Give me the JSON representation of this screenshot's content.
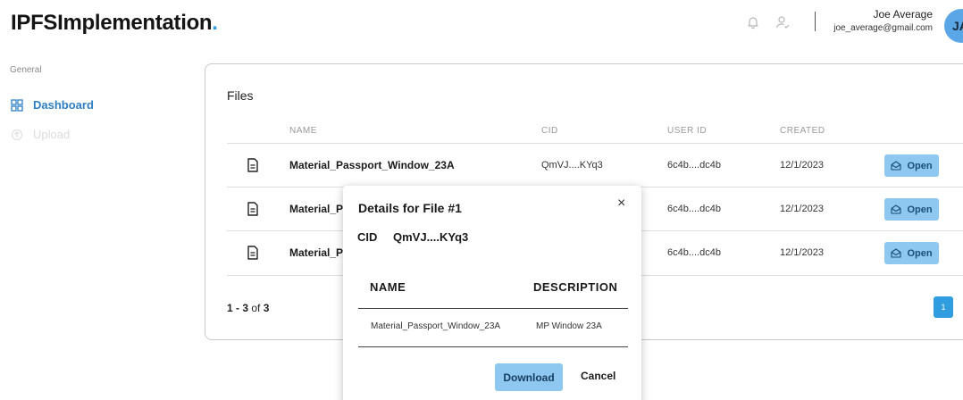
{
  "brand": {
    "name": "IPFSImplementation",
    "dot": "."
  },
  "header": {
    "icons": [
      "bell-icon",
      "person-icon"
    ],
    "user_name": "Joe Average",
    "user_email": "joe_average@gmail.com",
    "avatar_initials": "JA"
  },
  "sidebar": {
    "section": "General",
    "items": [
      {
        "label": "Dashboard",
        "icon": "dashboard-grid-icon",
        "active": true
      },
      {
        "label": "Upload",
        "icon": "upload-icon",
        "active": false
      }
    ]
  },
  "files": {
    "title": "Files",
    "columns": [
      "NAME",
      "CID",
      "USER ID",
      "CREATED"
    ],
    "rows": [
      {
        "name": "Material_Passport_Window_23A",
        "cid": "QmVJ....KYq3",
        "user_id": "6c4b....dc4b",
        "created": "12/1/2023",
        "action": "Open"
      },
      {
        "name": "Material_Pa",
        "cid": "",
        "user_id": "6c4b....dc4b",
        "created": "12/1/2023",
        "action": "Open"
      },
      {
        "name": "Material_Pa",
        "cid": "",
        "user_id": "6c4b....dc4b",
        "created": "12/1/2023",
        "action": "Open"
      }
    ],
    "pager": {
      "range": "1 - 3",
      "of": "of",
      "total": "3",
      "current_page": "1"
    }
  },
  "modal": {
    "title": "Details for File #1",
    "cid_label": "CID",
    "cid_value": "QmVJ....KYq3",
    "columns": [
      "NAME",
      "DESCRIPTION"
    ],
    "row": {
      "name": "Material_Passport_Window_23A",
      "description": "MP Window 23A"
    },
    "download_label": "Download",
    "cancel_label": "Cancel",
    "close_symbol": "×"
  },
  "colors": {
    "accent": "#2f9de0",
    "button": "#8ec8f0",
    "active_nav": "#2d7fc4"
  }
}
